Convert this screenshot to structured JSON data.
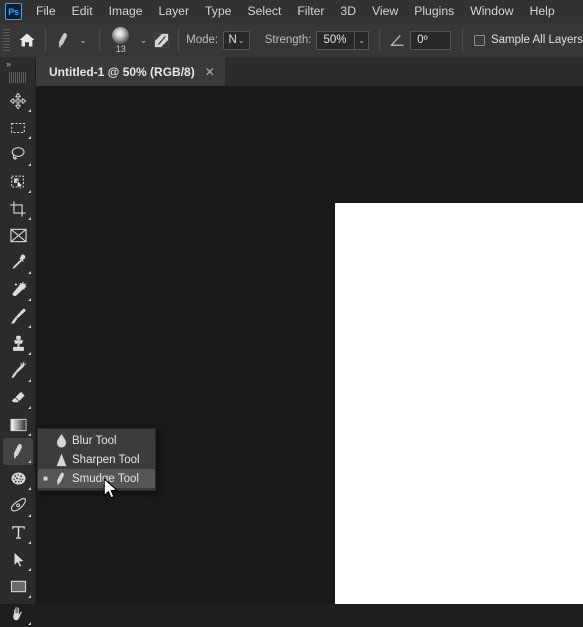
{
  "app": {
    "logo_text": "Ps",
    "accent_color": "#31a8ff"
  },
  "menubar": {
    "items": [
      {
        "label": "File"
      },
      {
        "label": "Edit"
      },
      {
        "label": "Image"
      },
      {
        "label": "Layer"
      },
      {
        "label": "Type"
      },
      {
        "label": "Select"
      },
      {
        "label": "Filter"
      },
      {
        "label": "3D"
      },
      {
        "label": "View"
      },
      {
        "label": "Plugins"
      },
      {
        "label": "Window"
      },
      {
        "label": "Help"
      }
    ]
  },
  "options_bar": {
    "home_icon": "home-icon",
    "tool_icon": "smudge-tool-icon",
    "tool_preset_chevron": "chevron-down-icon",
    "brush_preview_icon": "soft-round-brush-icon",
    "brush_size": "13",
    "brush_chevron": "chevron-down-icon",
    "airbrush_icon": "brush-settings-icon",
    "mode_label": "Mode:",
    "mode_value": "N",
    "mode_chevron": "chevron-down-icon",
    "strength_label": "Strength:",
    "strength_value": "50%",
    "strength_chevron": "chevron-down-icon",
    "angle_icon": "angle-icon",
    "angle_value": "0º",
    "sample_all_layers_label": "Sample All Layers",
    "sample_all_layers_checked": false
  },
  "tab_bar": {
    "tabs": [
      {
        "title": "Untitled-1 @ 50% (RGB/8)",
        "close_icon": "close-icon",
        "active": true
      }
    ]
  },
  "toolbar": {
    "collapse_label": "»",
    "tools": [
      {
        "name": "move-tool",
        "icon": "move-tool-icon",
        "has_submenu": true,
        "selected": false
      },
      {
        "name": "rectangular-marquee-tool",
        "icon": "rectangular-marquee-icon",
        "has_submenu": true,
        "selected": false
      },
      {
        "name": "lasso-tool",
        "icon": "lasso-icon",
        "has_submenu": true,
        "selected": false
      },
      {
        "name": "object-selection-tool",
        "icon": "object-selection-icon",
        "has_submenu": true,
        "selected": false
      },
      {
        "name": "crop-tool",
        "icon": "crop-icon",
        "has_submenu": true,
        "selected": false
      },
      {
        "name": "frame-tool",
        "icon": "frame-icon",
        "has_submenu": false,
        "selected": false
      },
      {
        "name": "eyedropper-tool",
        "icon": "eyedropper-icon",
        "has_submenu": true,
        "selected": false
      },
      {
        "name": "spot-healing-brush-tool",
        "icon": "spot-healing-brush-icon",
        "has_submenu": true,
        "selected": false
      },
      {
        "name": "brush-tool",
        "icon": "brush-icon",
        "has_submenu": true,
        "selected": false
      },
      {
        "name": "clone-stamp-tool",
        "icon": "clone-stamp-icon",
        "has_submenu": true,
        "selected": false
      },
      {
        "name": "history-brush-tool",
        "icon": "history-brush-icon",
        "has_submenu": true,
        "selected": false
      },
      {
        "name": "eraser-tool",
        "icon": "eraser-icon",
        "has_submenu": true,
        "selected": false
      },
      {
        "name": "gradient-tool",
        "icon": "gradient-icon",
        "has_submenu": true,
        "selected": false
      },
      {
        "name": "smudge-tool",
        "icon": "smudge-tool-icon",
        "has_submenu": true,
        "selected": true
      },
      {
        "name": "sponge-tool",
        "icon": "sponge-icon",
        "has_submenu": true,
        "selected": false
      },
      {
        "name": "pen-tool",
        "icon": "pen-icon",
        "has_submenu": true,
        "selected": false
      },
      {
        "name": "horizontal-type-tool",
        "icon": "type-icon",
        "has_submenu": true,
        "selected": false
      },
      {
        "name": "path-selection-tool",
        "icon": "path-selection-icon",
        "has_submenu": true,
        "selected": false
      },
      {
        "name": "rectangle-tool",
        "icon": "rectangle-shape-icon",
        "has_submenu": true,
        "selected": false
      },
      {
        "name": "hand-tool",
        "icon": "hand-icon",
        "has_submenu": true,
        "selected": false
      }
    ]
  },
  "flyout_menu": {
    "items": [
      {
        "label": "Blur Tool",
        "icon": "blur-tool-icon",
        "active": false,
        "bullet": ""
      },
      {
        "label": "Sharpen Tool",
        "icon": "sharpen-tool-icon",
        "active": false,
        "bullet": ""
      },
      {
        "label": "Smudge Tool",
        "icon": "smudge-tool-icon",
        "active": true,
        "bullet": "■"
      }
    ]
  },
  "canvas": {
    "document_color": "#ffffff",
    "workspace_color": "#1a1a1a"
  }
}
